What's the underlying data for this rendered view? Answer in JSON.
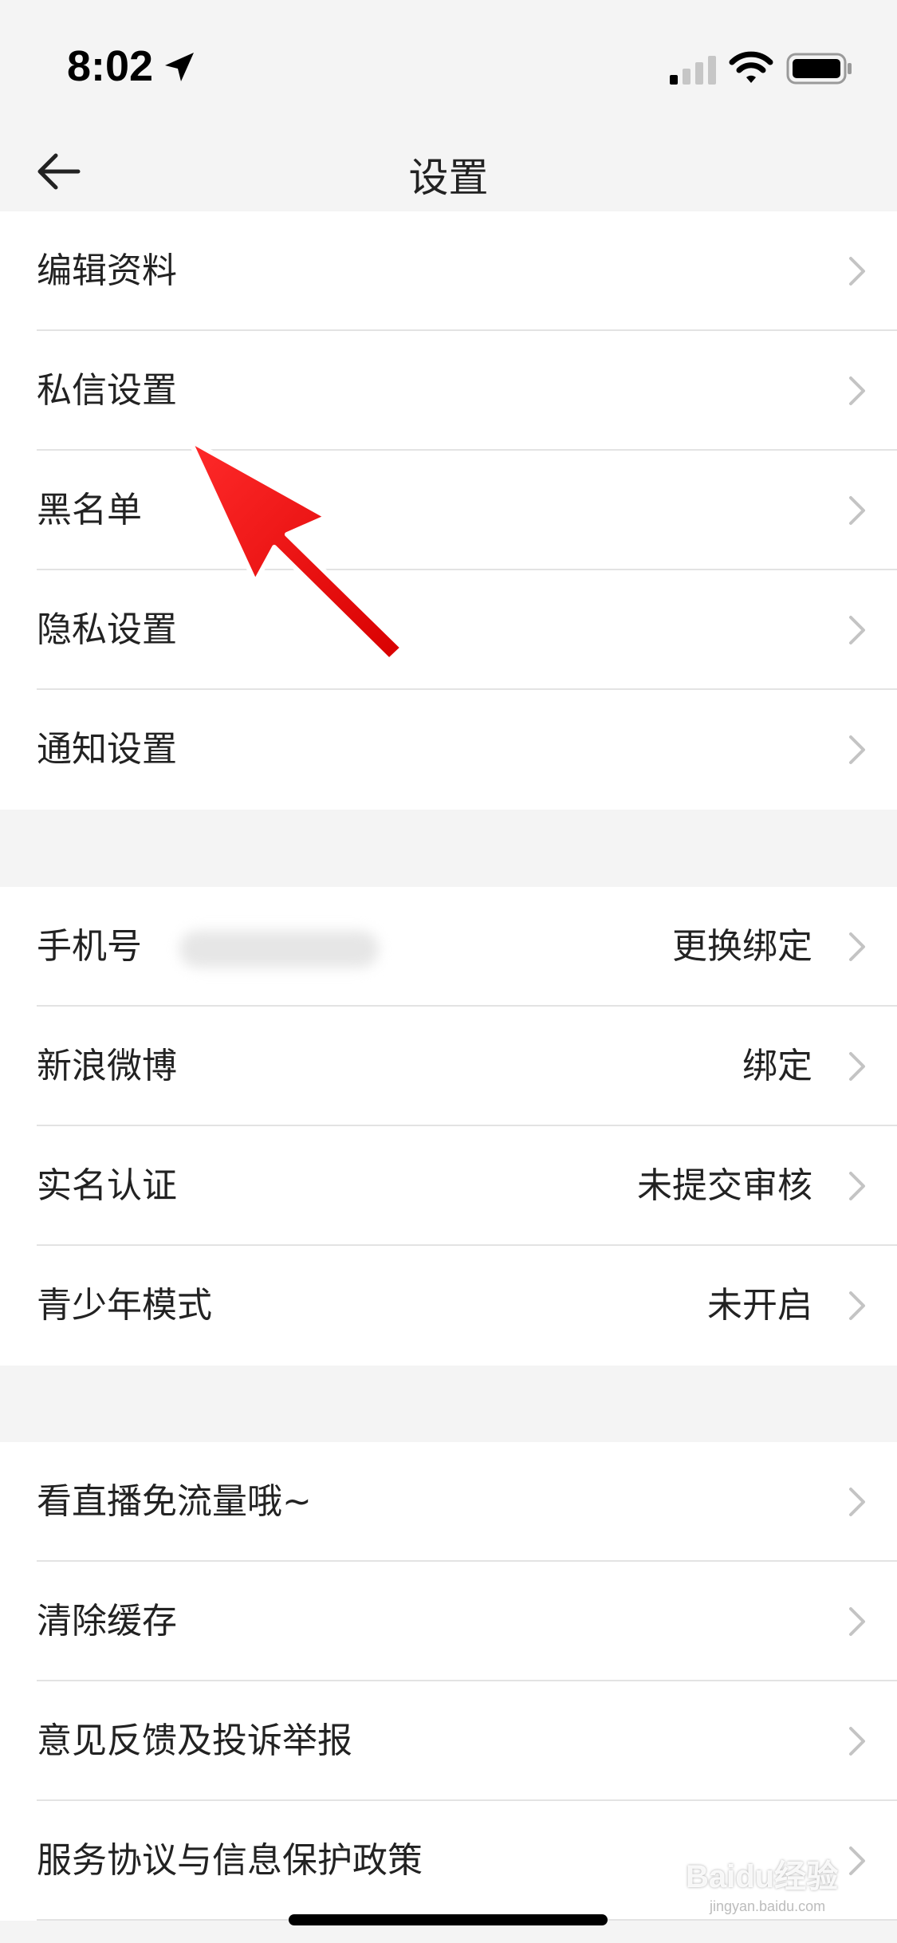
{
  "status_bar": {
    "time": "8:02"
  },
  "nav": {
    "title": "设置"
  },
  "group1": [
    {
      "label": "编辑资料"
    },
    {
      "label": "私信设置"
    },
    {
      "label": "黑名单"
    },
    {
      "label": "隐私设置"
    },
    {
      "label": "通知设置"
    }
  ],
  "group2": [
    {
      "label": "手机号",
      "value": "更换绑定"
    },
    {
      "label": "新浪微博",
      "value": "绑定"
    },
    {
      "label": "实名认证",
      "value": "未提交审核"
    },
    {
      "label": "青少年模式",
      "value": "未开启"
    }
  ],
  "group3": [
    {
      "label": "看直播免流量哦~"
    },
    {
      "label": "清除缓存"
    },
    {
      "label": "意见反馈及投诉举报"
    },
    {
      "label": "服务协议与信息保护政策"
    }
  ],
  "watermark": {
    "brand": "Baidu经验",
    "url": "jingyan.baidu.com"
  },
  "colors": {
    "background": "#f4f4f4",
    "row_bg": "#ffffff",
    "text": "#222222",
    "divider": "#e3e3e3",
    "chevron": "#c4c4c4",
    "annotation_arrow": "#ff0000"
  }
}
